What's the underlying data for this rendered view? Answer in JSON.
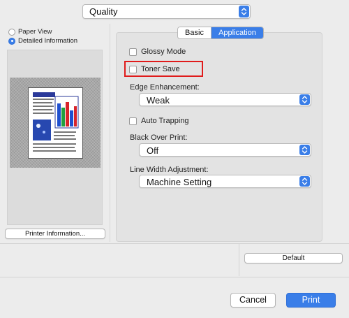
{
  "panel_select": {
    "value": "Quality"
  },
  "view_options": [
    {
      "label": "Paper View",
      "selected": false
    },
    {
      "label": "Detailed Information",
      "selected": true
    }
  ],
  "printer_info_button": "Printer Information...",
  "tabs": [
    {
      "label": "Basic",
      "active": false
    },
    {
      "label": "Application",
      "active": true
    }
  ],
  "options": {
    "glossy_mode": {
      "label": "Glossy Mode",
      "checked": false
    },
    "toner_save": {
      "label": "Toner Save",
      "checked": false,
      "highlighted": true
    },
    "edge_enhancement": {
      "label": "Edge Enhancement:",
      "value": "Weak"
    },
    "auto_trapping": {
      "label": "Auto Trapping",
      "checked": false
    },
    "black_over_print": {
      "label": "Black Over Print:",
      "value": "Off"
    },
    "line_width_adjustment": {
      "label": "Line Width Adjustment:",
      "value": "Machine Setting"
    }
  },
  "buttons": {
    "default": "Default",
    "cancel": "Cancel",
    "print": "Print"
  },
  "icons": {
    "select_stepper": "chevron-up-down-icon",
    "preview": "document-preview-icon"
  },
  "colors": {
    "accent": "#3a7ee8",
    "highlight": "#e01b1b"
  }
}
